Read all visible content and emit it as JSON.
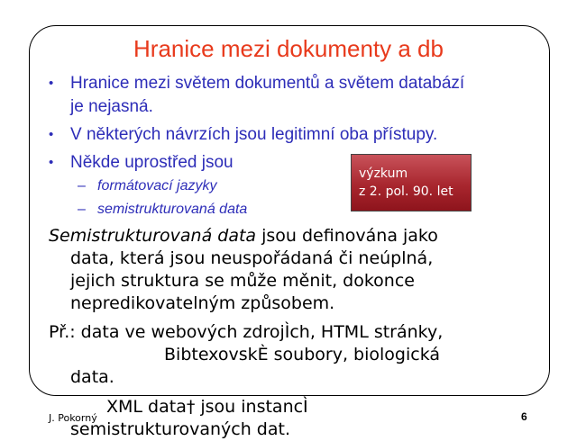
{
  "slide": {
    "title": "Hranice mezi dokumenty a db",
    "bullets": [
      {
        "line1": "Hranice mezi světem dokumentů a světem databází",
        "line2": "je nejasná."
      },
      {
        "line1": "V některých návrzích jsou legitimní oba přístupy."
      },
      {
        "line1": "Někde uprostřed jsou"
      }
    ],
    "sub_bullets": [
      "formátovací jazyky",
      "semistrukturovaná data"
    ],
    "callout": {
      "line1": "výzkum",
      "line2": "z 2. pol. 90. let"
    },
    "paragraph1": {
      "emph": "Semistrukturovaná data",
      "rest": " jsou definována jako",
      "lines": [
        "data, která jsou neuspořádaná či neúplná,",
        "jejich struktura se může měnit, dokonce",
        "nepredikovatelným způsobem."
      ]
    },
    "paragraph2": {
      "line1": "Př.: data ve webových zdrojÌch, HTML stránky,",
      "line2": "BibtexovskÈ soubory, biologická",
      "line3": "data."
    },
    "paragraph3": {
      "line1": "XML data† jsou instancÌ",
      "line2": "semistrukturovaných dat."
    },
    "footer": {
      "author": "J. Pokorný",
      "page": "6"
    }
  },
  "colors": {
    "title": "#e83a1c",
    "bullet_text": "#2d2db8",
    "callout_bg": "#a8262e"
  }
}
